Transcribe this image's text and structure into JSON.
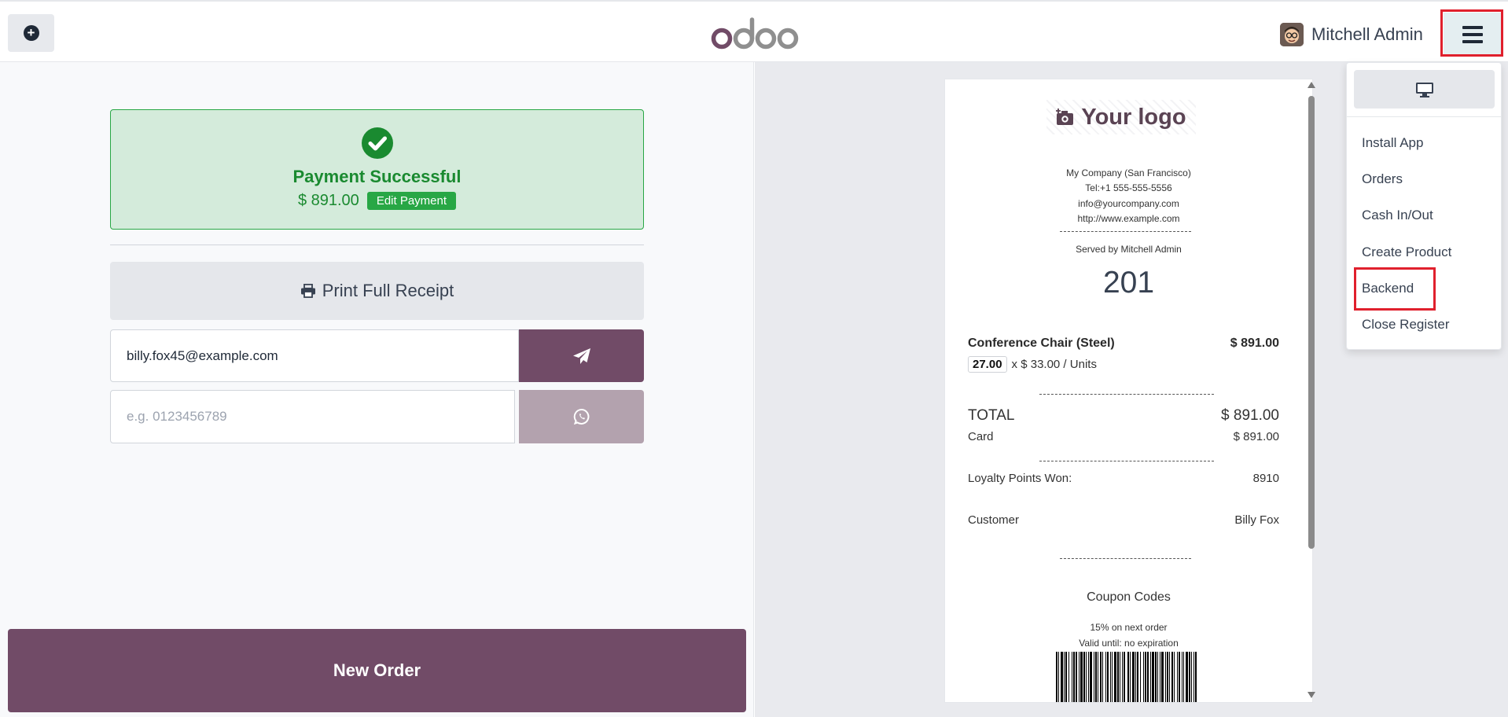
{
  "header": {
    "add_button_icon": "plus-circle-icon",
    "logo_text": "odoo",
    "user_name": "Mitchell Admin",
    "menu_icon": "hamburger-icon"
  },
  "payment": {
    "title": "Payment Successful",
    "amount": "$ 891.00",
    "edit_label": "Edit Payment",
    "print_label": "Print Full Receipt",
    "email_value": "billy.fox45@example.com",
    "phone_placeholder": "e.g. 0123456789",
    "new_order_label": "New Order"
  },
  "receipt": {
    "logo_text": "Your logo",
    "company": "My Company (San Francisco)",
    "tel": "Tel:+1 555-555-5556",
    "email": "info@yourcompany.com",
    "website": "http://www.example.com",
    "served_by": "Served by Mitchell Admin",
    "ticket_number": "201",
    "line": {
      "product": "Conference Chair (Steel)",
      "price": "$ 891.00",
      "qty": "27.00",
      "unit_price": "x $ 33.00 / Units"
    },
    "total_label": "TOTAL",
    "total_value": "$ 891.00",
    "payment_method": "Card",
    "payment_value": "$ 891.00",
    "loyalty_label": "Loyalty Points Won:",
    "loyalty_value": "8910",
    "customer_label": "Customer",
    "customer_value": "Billy Fox",
    "coupon_title": "Coupon Codes",
    "coupon_desc": "15% on next order",
    "coupon_valid": "Valid until: no expiration"
  },
  "menu": {
    "screen_icon": "desktop-icon",
    "items": [
      "Install App",
      "Orders",
      "Cash In/Out",
      "Create Product",
      "Backend",
      "Close Register"
    ]
  },
  "colors": {
    "brand": "#714b67",
    "success": "#28a745",
    "highlight": "#e0202d"
  }
}
